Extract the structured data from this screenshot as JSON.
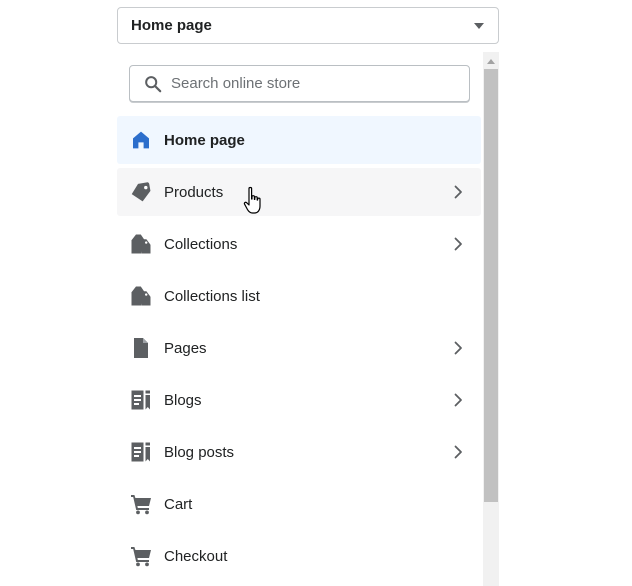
{
  "dropdown": {
    "selected": "Home page",
    "icon": "caret-down-icon"
  },
  "search": {
    "placeholder": "Search online store",
    "value": ""
  },
  "items": [
    {
      "label": "Home page",
      "icon": "home-icon",
      "has_children": false,
      "state": "selected"
    },
    {
      "label": "Products",
      "icon": "tag-icon",
      "has_children": true,
      "state": "hover"
    },
    {
      "label": "Collections",
      "icon": "collections-icon",
      "has_children": true,
      "state": ""
    },
    {
      "label": "Collections list",
      "icon": "collections-icon",
      "has_children": false,
      "state": ""
    },
    {
      "label": "Pages",
      "icon": "page-icon",
      "has_children": true,
      "state": ""
    },
    {
      "label": "Blogs",
      "icon": "blog-icon",
      "has_children": true,
      "state": ""
    },
    {
      "label": "Blog posts",
      "icon": "blog-icon",
      "has_children": true,
      "state": ""
    },
    {
      "label": "Cart",
      "icon": "cart-icon",
      "has_children": false,
      "state": ""
    },
    {
      "label": "Checkout",
      "icon": "cart-icon",
      "has_children": false,
      "state": ""
    }
  ],
  "colors": {
    "accent": "#2c6ecb",
    "icon": "#5c5f62",
    "selected_bg": "#f0f7ff",
    "hover_bg": "#f6f6f7"
  }
}
